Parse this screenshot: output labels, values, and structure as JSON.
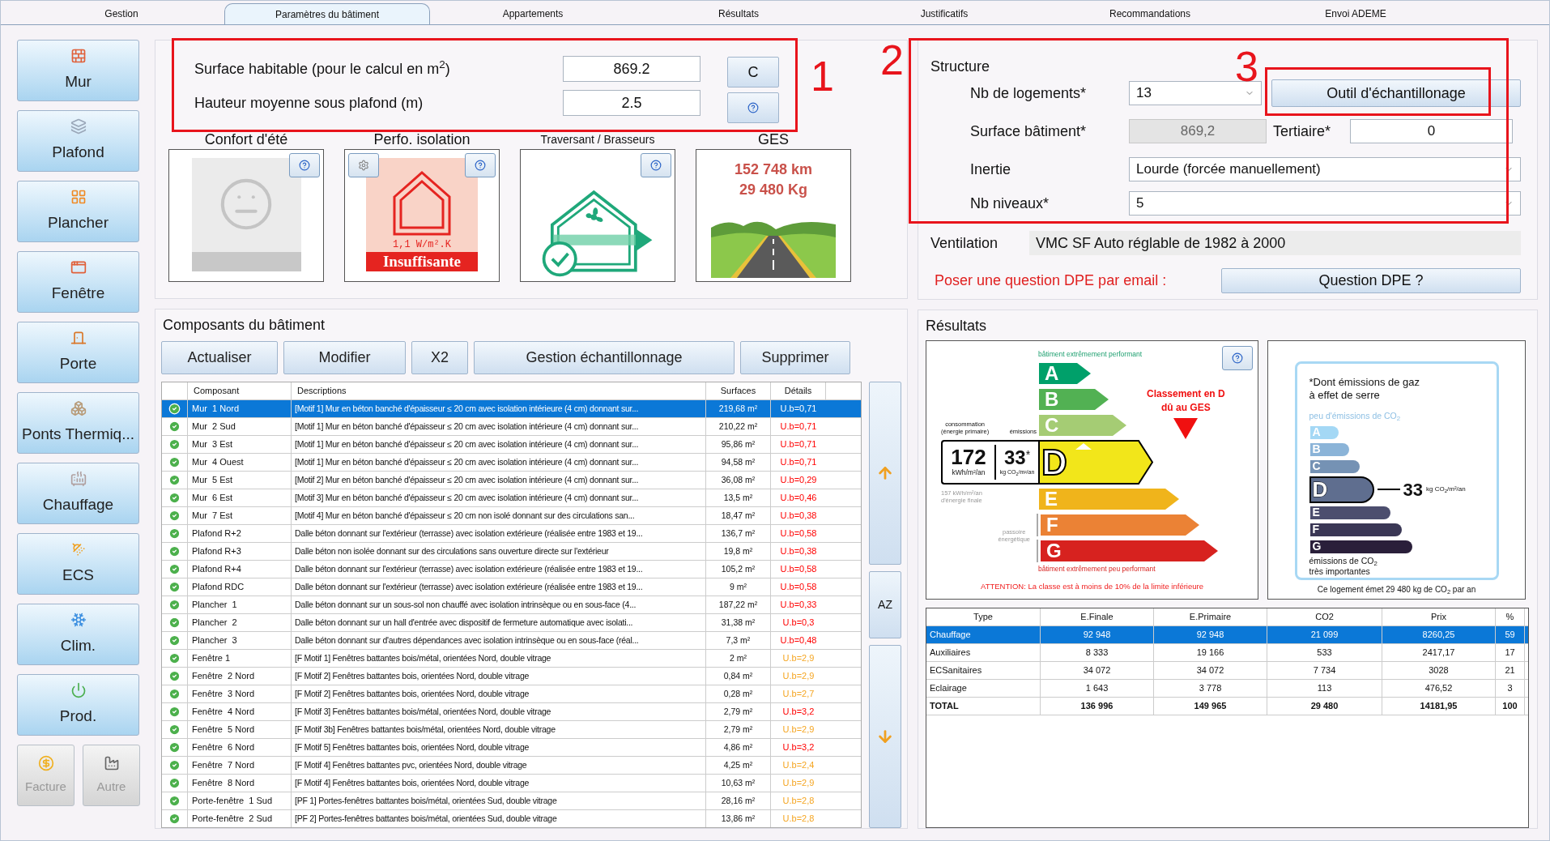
{
  "tabs": [
    {
      "label": "Gestion",
      "selected": false
    },
    {
      "label": "Paramètres du bâtiment",
      "selected": true
    },
    {
      "label": "Appartements",
      "selected": false
    },
    {
      "label": "Résultats",
      "selected": false
    },
    {
      "label": "Justificatifs",
      "selected": false
    },
    {
      "label": "Recommandations",
      "selected": false
    },
    {
      "label": "Envoi ADEME",
      "selected": false
    }
  ],
  "sidebar": {
    "items": [
      {
        "label": "Mur",
        "kind": "large",
        "disabled": false
      },
      {
        "label": "Plafond",
        "kind": "large",
        "disabled": false
      },
      {
        "label": "Plancher",
        "kind": "large",
        "disabled": false
      },
      {
        "label": "Fenêtre",
        "kind": "large",
        "disabled": false
      },
      {
        "label": "Porte",
        "kind": "large",
        "disabled": false
      },
      {
        "label": "Ponts Thermiq...",
        "kind": "large",
        "disabled": false
      },
      {
        "label": "Chauffage",
        "kind": "large",
        "disabled": false
      },
      {
        "label": "ECS",
        "kind": "large",
        "disabled": false
      },
      {
        "label": "Clim.",
        "kind": "large",
        "disabled": false
      },
      {
        "label": "Prod.",
        "kind": "large",
        "disabled": false
      },
      {
        "label": "Facture",
        "kind": "small",
        "disabled": true
      },
      {
        "label": "Autre",
        "kind": "small",
        "disabled": true
      }
    ]
  },
  "surface_panel": {
    "fields": [
      {
        "label": "Surface habitable (pour le calcul en m$^{2}$)",
        "value": "869.2"
      },
      {
        "label": "Hauteur moyenne sous plafond (m)",
        "value": "2.5"
      }
    ],
    "c_button": "C"
  },
  "cards": [
    {
      "kind": "confort",
      "title": "Confort d'été"
    },
    {
      "kind": "isolation",
      "title": "Perfo. isolation",
      "value": "1,1 W/m².K",
      "rating": "Insuffisante"
    },
    {
      "kind": "traversant",
      "title": "Traversant / Brasseurs"
    },
    {
      "kind": "ges",
      "title": "GES",
      "lines": [
        "152 748 km",
        "29 480 Kg"
      ]
    }
  ],
  "structure": {
    "title": "Structure",
    "nb_logements": {
      "label": "Nb de logements*",
      "value": "13"
    },
    "outil_button": "Outil d'échantillonage",
    "surface_batiment": {
      "label": "Surface bâtiment*",
      "value": "869,2",
      "disabled": true
    },
    "tertiaire": {
      "label": "Tertiaire*",
      "value": "0"
    },
    "inertie": {
      "label": "Inertie",
      "value": "Lourde (forcée manuellement)"
    },
    "nb_niveaux": {
      "label": "Nb niveaux*",
      "value": "5"
    }
  },
  "ventilation": {
    "label": "Ventilation",
    "value": "VMC SF Auto réglable de 1982 à 2000"
  },
  "question": {
    "text": "Poser une question DPE par email :",
    "button": "Question DPE ?"
  },
  "composants": {
    "title": "Composants du bâtiment",
    "buttons": [
      "Actualiser",
      "Modifier",
      "X2",
      "Gestion échantillonnage",
      "Supprimer"
    ],
    "columns": [
      "Composant",
      "Descriptions",
      "Surfaces",
      "Détails"
    ],
    "rows": [
      {
        "composant": "Mur  1 Nord",
        "description": "[Motif 1] Mur en béton banché d'épaisseur ≤ 20 cm avec isolation intérieure (4 cm) donnant sur...",
        "surface": "219,68 m²",
        "detail": "U.b=0,71",
        "selected": true
      },
      {
        "composant": "Mur  2 Sud",
        "description": "[Motif 1] Mur en béton banché d'épaisseur ≤ 20 cm avec isolation intérieure (4 cm) donnant sur...",
        "surface": "210,22 m²",
        "detail": "U.b=0,71",
        "kind": "alert",
        "selected": false
      },
      {
        "composant": "Mur  3 Est",
        "description": "[Motif 1] Mur en béton banché d'épaisseur ≤ 20 cm avec isolation intérieure (4 cm) donnant sur...",
        "surface": "95,86 m²",
        "detail": "U.b=0,71",
        "kind": "alert",
        "selected": false
      },
      {
        "composant": "Mur  4 Ouest",
        "description": "[Motif 1] Mur en béton banché d'épaisseur ≤ 20 cm avec isolation intérieure (4 cm) donnant sur...",
        "surface": "94,58 m²",
        "detail": "U.b=0,71",
        "kind": "alert",
        "selected": false
      },
      {
        "composant": "Mur  5 Est",
        "description": "[Motif 2] Mur en béton banché d'épaisseur ≤ 20 cm avec isolation intérieure (4 cm) donnant sur...",
        "surface": "36,08 m²",
        "detail": "U.b=0,29",
        "kind": "alert",
        "selected": false
      },
      {
        "composant": "Mur  6 Est",
        "description": "[Motif 3] Mur en béton banché d'épaisseur ≤ 20 cm avec isolation intérieure (4 cm) donnant sur...",
        "surface": "13,5 m²",
        "detail": "U.b=0,46",
        "kind": "alert",
        "selected": false
      },
      {
        "composant": "Mur  7 Est",
        "description": "[Motif 4] Mur en béton banché d'épaisseur ≤ 20 cm non isolé donnant sur des circulations san...",
        "surface": "18,47 m²",
        "detail": "U.b=0,38",
        "kind": "alert",
        "selected": false
      },
      {
        "composant": "Plafond R+2",
        "description": "Dalle béton donnant sur l'extérieur (terrasse) avec isolation extérieure (réalisée entre 1983 et 19...",
        "surface": "136,7 m²",
        "detail": "U.b=0,58",
        "kind": "alert",
        "selected": false
      },
      {
        "composant": "Plafond R+3",
        "description": "Dalle béton non isolée donnant sur des circulations sans ouverture directe sur l'extérieur",
        "surface": "19,8 m²",
        "detail": "U.b=0,38",
        "kind": "alert",
        "selected": false
      },
      {
        "composant": "Plafond R+4",
        "description": "Dalle béton donnant sur l'extérieur (terrasse) avec isolation extérieure (réalisée entre 1983 et 19...",
        "surface": "105,2 m²",
        "detail": "U.b=0,58",
        "kind": "alert",
        "selected": false
      },
      {
        "composant": "Plafond RDC",
        "description": "Dalle béton donnant sur l'extérieur (terrasse) avec isolation extérieure (réalisée entre 1983 et 19...",
        "surface": "9 m²",
        "detail": "U.b=0,58",
        "kind": "alert",
        "selected": false
      },
      {
        "composant": "Plancher  1",
        "description": "Dalle béton donnant sur un sous-sol non chauffé avec isolation intrinsèque ou en sous-face (4...",
        "surface": "187,22 m²",
        "detail": "U.b=0,33",
        "kind": "alert",
        "selected": false
      },
      {
        "composant": "Plancher  2",
        "description": "Dalle béton donnant sur un hall d'entrée avec dispositif de fermeture automatique avec isolati...",
        "surface": "31,38 m²",
        "detail": "U.b=0,3",
        "kind": "alert",
        "selected": false
      },
      {
        "composant": "Plancher  3",
        "description": "Dalle béton donnant sur d'autres dépendances avec isolation intrinsèque ou en sous-face (réal...",
        "surface": "7,3 m²",
        "detail": "U.b=0,48",
        "kind": "alert",
        "selected": false
      },
      {
        "composant": "Fenêtre 1",
        "description": "[F Motif 1] Fenêtres battantes bois/métal, orientées Nord, double vitrage",
        "surface": "2 m²",
        "detail": "U.b=2,9",
        "kind": "warning",
        "selected": false
      },
      {
        "composant": "Fenêtre  2 Nord",
        "description": "[F Motif 2] Fenêtres battantes bois, orientées Nord, double vitrage",
        "surface": "0,84 m²",
        "detail": "U.b=2,9",
        "kind": "warning",
        "selected": false
      },
      {
        "composant": "Fenêtre  3 Nord",
        "description": "[F Motif 2] Fenêtres battantes bois, orientées Nord, double vitrage",
        "surface": "0,28 m²",
        "detail": "U.b=2,7",
        "kind": "warning",
        "selected": false
      },
      {
        "composant": "Fenêtre  4 Nord",
        "description": "[F Motif 3] Fenêtres battantes bois/métal, orientées Nord, double vitrage",
        "surface": "2,79 m²",
        "detail": "U.b=3,2",
        "kind": "alert",
        "selected": false
      },
      {
        "composant": "Fenêtre  5 Nord",
        "description": "[F Motif 3b] Fenêtres battantes bois/métal, orientées Nord, double vitrage",
        "surface": "2,79 m²",
        "detail": "U.b=2,9",
        "kind": "warning",
        "selected": false
      },
      {
        "composant": "Fenêtre  6 Nord",
        "description": "[F Motif 5] Fenêtres battantes bois, orientées Nord, double vitrage",
        "surface": "4,86 m²",
        "detail": "U.b=3,2",
        "kind": "alert",
        "selected": false
      },
      {
        "composant": "Fenêtre  7 Nord",
        "description": "[F Motif 4] Fenêtres battantes pvc, orientées Nord, double vitrage",
        "surface": "4,25 m²",
        "detail": "U.b=2,4",
        "kind": "warning",
        "selected": false
      },
      {
        "composant": "Fenêtre  8 Nord",
        "description": "[F Motif 4] Fenêtres battantes bois, orientées Nord, double vitrage",
        "surface": "10,63 m²",
        "detail": "U.b=2,9",
        "kind": "warning",
        "selected": false
      },
      {
        "composant": "Porte-fenêtre  1 Sud",
        "description": "[PF 1] Portes-fenêtres battantes bois/métal, orientées Sud, double vitrage",
        "surface": "28,16 m²",
        "detail": "U.b=2,8",
        "kind": "warning",
        "selected": false
      },
      {
        "composant": "Porte-fenêtre  2 Sud",
        "description": "[PF 2] Portes-fenêtres battantes bois/métal, orientées Sud, double vitrage",
        "surface": "13,86 m²",
        "detail": "U.b=2,8",
        "kind": "warning",
        "selected": false
      }
    ],
    "sort_button": "AZ"
  },
  "resultats": {
    "title": "Résultats",
    "dpe": {
      "top_label": "bâtiment extrêmement performant",
      "bottom_label": "bâtiment extrêmement peu performant",
      "classes": [
        {
          "letter": "A",
          "color": "#00a06a",
          "selected": false
        },
        {
          "letter": "B",
          "color": "#52b153",
          "selected": false
        },
        {
          "letter": "C",
          "color": "#a5cc74",
          "selected": false
        },
        {
          "letter": "D",
          "color": "#f2e61a",
          "selected": true
        },
        {
          "letter": "E",
          "color": "#f0b41b",
          "selected": false
        },
        {
          "letter": "F",
          "color": "#eb8235",
          "selected": false
        },
        {
          "letter": "G",
          "color": "#d7221f",
          "selected": false
        }
      ],
      "consumption_caption": [
        "consommation",
        "(énergie primaire)"
      ],
      "emissions_caption": "émissions",
      "consumption": "172",
      "consumption_unit": "kWh/m²/an",
      "emissions": "33",
      "emissions_mark": "*",
      "emissions_unit": "kg CO$_{2}$/m²/an",
      "final": [
        "157 kWh/m²/an",
        "d'énergie finale"
      ],
      "passoire": [
        "passoire",
        "énergétique"
      ],
      "classement": [
        "Classement en D",
        "dû au GES"
      ],
      "warning": "ATTENTION: La classe est à moins de 10% de la limite inférieure"
    },
    "co2": {
      "note": [
        "*Dont émissions de gaz",
        "à effet de serre"
      ],
      "top": "peu d'émissions de CO$_{2}$",
      "classes": [
        {
          "letter": "A",
          "color": "#a4d8f5",
          "selected": false
        },
        {
          "letter": "B",
          "color": "#8bb4d8",
          "selected": false
        },
        {
          "letter": "C",
          "color": "#7592b4",
          "selected": false
        },
        {
          "letter": "D",
          "color": "#5f6e8f",
          "selected": true
        },
        {
          "letter": "E",
          "color": "#4c4e6e",
          "selected": false
        },
        {
          "letter": "F",
          "color": "#3a3755",
          "selected": false
        },
        {
          "letter": "G",
          "color": "#2a1f3a",
          "selected": false
        }
      ],
      "value": "33",
      "unit": "kg CO$_{2}$/m²/an",
      "bottom": [
        "émissions de CO$_{2}$",
        "très importantes"
      ],
      "caption": "Ce logement émet 29 480 kg de CO$_{2}$ par an"
    },
    "table": {
      "columns": [
        "Type",
        "E.Finale",
        "E.Primaire",
        "CO2",
        "Prix",
        "%"
      ],
      "rows": [
        {
          "kind": "item",
          "selected": true,
          "cells": [
            "Chauffage",
            "92 948",
            "92 948",
            "21 099",
            "8260,25",
            "59"
          ]
        },
        {
          "kind": "item",
          "selected": false,
          "cells": [
            "Auxiliaires",
            "8 333",
            "19 166",
            "533",
            "2417,17",
            "17"
          ]
        },
        {
          "kind": "item",
          "selected": false,
          "cells": [
            "ECSanitaires",
            "34 072",
            "34 072",
            "7 734",
            "3028",
            "21"
          ]
        },
        {
          "kind": "item",
          "selected": false,
          "cells": [
            "Eclairage",
            "1 643",
            "3 778",
            "113",
            "476,52",
            "3"
          ]
        },
        {
          "kind": "total",
          "selected": false,
          "cells": [
            "TOTAL",
            "136 996",
            "149 965",
            "29 480",
            "14181,95",
            "100"
          ]
        }
      ]
    }
  },
  "annotations": [
    {
      "label": "1"
    },
    {
      "label": "2"
    },
    {
      "label": "3"
    }
  ]
}
